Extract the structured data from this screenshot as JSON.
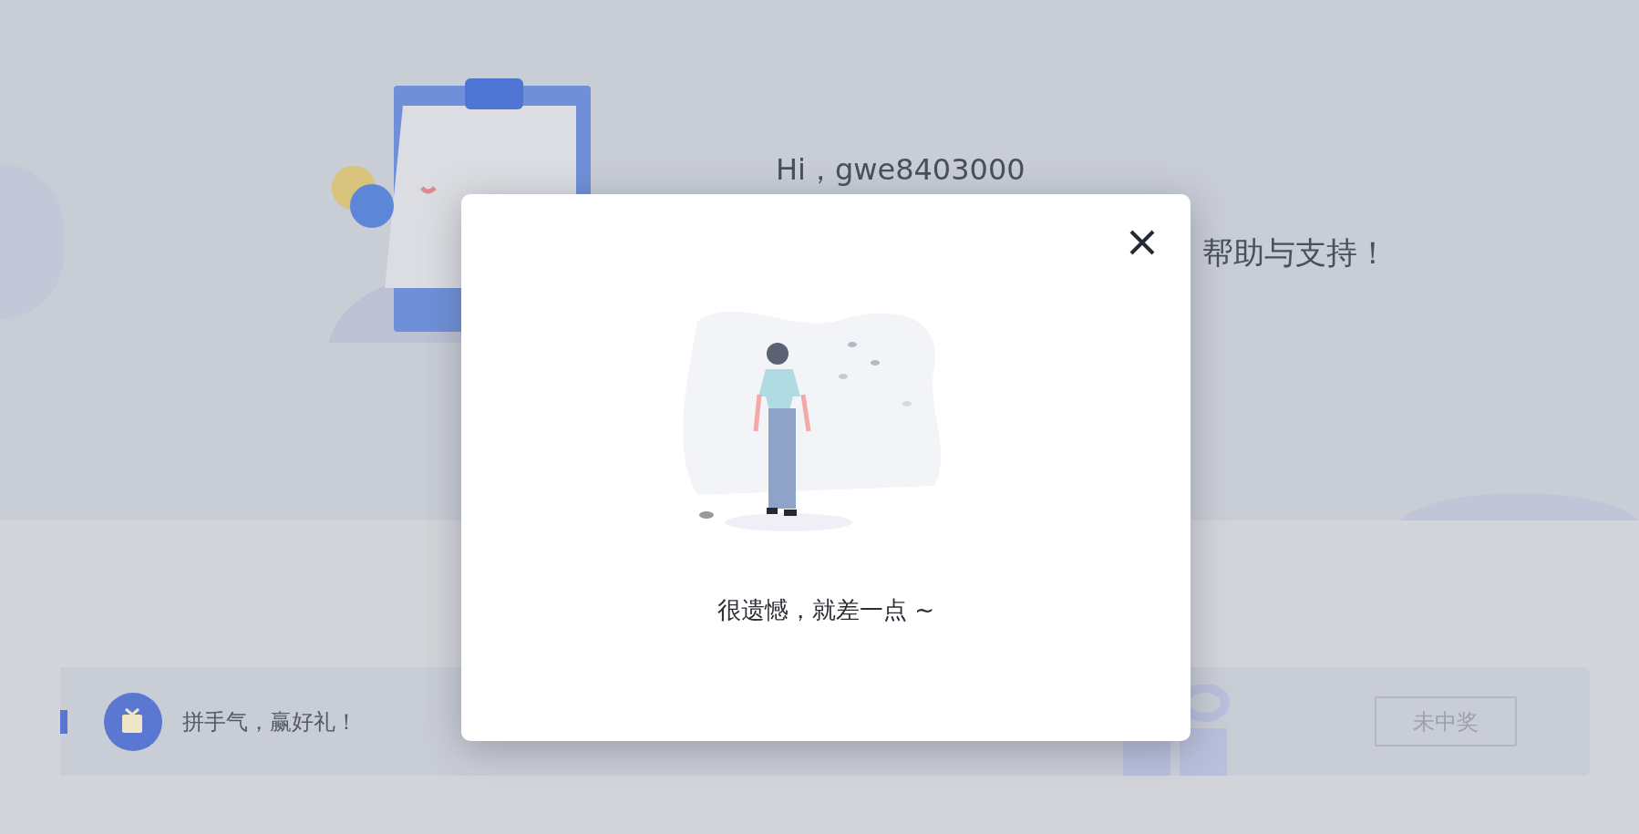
{
  "header": {
    "greeting": "Hi，gwe8403000",
    "thanks": "帮助与支持！"
  },
  "banner": {
    "title": "拼手气，赢好礼！",
    "result_button": {
      "label": "未中奖",
      "disabled": true
    }
  },
  "dialog": {
    "message": "很遗憾，就差一点 ~"
  }
}
